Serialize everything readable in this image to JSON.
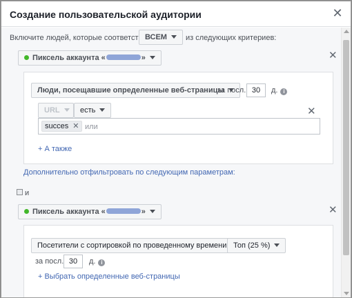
{
  "dialog": {
    "title": "Создание пользовательской аудитории",
    "close_icon": "close-icon"
  },
  "criteria": {
    "include_label": "Включите людей, которые соответствуют",
    "match_value": "ВСЕМ",
    "suffix_label": "из следующих критериев:"
  },
  "source1": {
    "label_prefix": "Пиксель аккаунта «",
    "label_suffix": "»",
    "status_color": "#42b72a",
    "event_select": "Люди, посещавшие определенные веб-страницы",
    "days_prefix": "за посл.",
    "days_value": "30",
    "days_suffix": "д.",
    "rule": {
      "field": "URL",
      "operator": "есть",
      "tokens": [
        "succes"
      ],
      "input_placeholder": "или"
    },
    "also_link": "+ А также",
    "filter_link": "Дополнительно отфильтровать по следующим параметрам:"
  },
  "joiner": {
    "label": "и"
  },
  "source2": {
    "label_prefix": "Пиксель аккаунта «",
    "label_suffix": "»",
    "status_color": "#42b72a",
    "event_select": "Посетители с сортировкой по проведенному времени",
    "top_select": "Топ (25 %)",
    "days_prefix": "за посл.",
    "days_value": "30",
    "days_suffix": "д.",
    "pages_link": "+ Выбрать определенные веб-страницы"
  },
  "colors": {
    "accent": "#4267b2",
    "border": "#dddfe2",
    "background": "#f6f7f9"
  }
}
